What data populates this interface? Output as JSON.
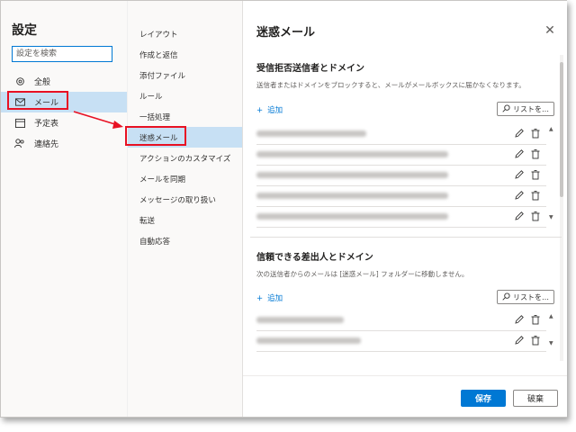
{
  "settings": {
    "title": "設定",
    "search_placeholder": "設定を検索"
  },
  "left_nav": [
    {
      "label": "全般",
      "icon": "gear-icon"
    },
    {
      "label": "メール",
      "icon": "mail-icon",
      "selected": true
    },
    {
      "label": "予定表",
      "icon": "calendar-icon"
    },
    {
      "label": "連絡先",
      "icon": "people-icon"
    }
  ],
  "mid_nav": [
    {
      "label": "レイアウト"
    },
    {
      "label": "作成と返信"
    },
    {
      "label": "添付ファイル"
    },
    {
      "label": "ルール"
    },
    {
      "label": "一括処理"
    },
    {
      "label": "迷惑メール",
      "selected": true
    },
    {
      "label": "アクションのカスタマイズ"
    },
    {
      "label": "メールを同期"
    },
    {
      "label": "メッセージの取り扱い"
    },
    {
      "label": "転送"
    },
    {
      "label": "自動応答"
    }
  ],
  "pane": {
    "title": "迷惑メール",
    "close_icon": "close-icon",
    "blocked": {
      "heading": "受信拒否送信者とドメイン",
      "description": "送信者またはドメインをブロックすると、メールがメールボックスに届かなくなります。",
      "add_label": "追加",
      "search_label": "リストを…",
      "rows": [
        {
          "blur_width": 0.38
        },
        {
          "blur_width": 0.66
        },
        {
          "blur_width": 0.66
        },
        {
          "blur_width": 0.66
        },
        {
          "blur_width": 0.66
        }
      ]
    },
    "trusted": {
      "heading": "信頼できる差出人とドメイン",
      "description": "次の送信者からのメールは [迷惑メール] フォルダーに移動しません。",
      "add_label": "追加",
      "search_label": "リストを…",
      "rows": [
        {
          "blur_width": 0.3
        },
        {
          "blur_width": 0.36
        }
      ]
    },
    "save_label": "保存",
    "discard_label": "破棄"
  },
  "colors": {
    "accent": "#0078d4",
    "selected_bg": "#c7e0f4",
    "highlight_red": "#e81123"
  }
}
